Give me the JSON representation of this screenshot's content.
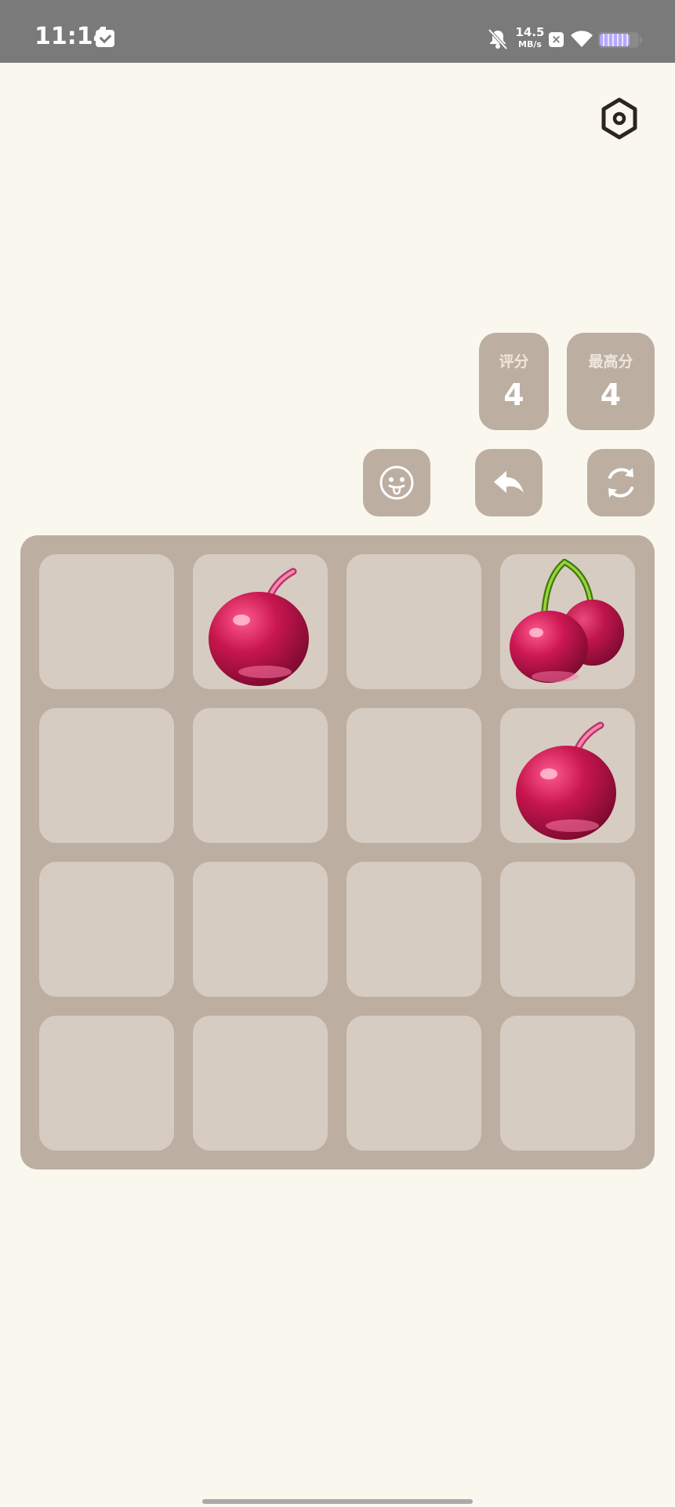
{
  "status_bar": {
    "time": "11:14",
    "network_speed_value": "14.5",
    "network_speed_unit": "MB/s",
    "battery_level": 0.8,
    "icons": [
      "mail-icon",
      "mute-icon",
      "data-x-icon",
      "wifi-icon",
      "battery-icon"
    ]
  },
  "header": {
    "settings_icon": "hexagon-settings-icon"
  },
  "score": {
    "label": "评分",
    "value": "4"
  },
  "best": {
    "label": "最高分",
    "value": "4"
  },
  "actions": [
    {
      "name": "emoji-button",
      "icon": "tongue-face-icon"
    },
    {
      "name": "undo-button",
      "icon": "back-arrow-icon"
    },
    {
      "name": "restart-button",
      "icon": "refresh-icon"
    }
  ],
  "board": {
    "rows": 4,
    "cols": 4,
    "tiles": [
      [
        "empty",
        "cherry-single",
        "empty",
        "cherry-double"
      ],
      [
        "empty",
        "empty",
        "empty",
        "cherry-single"
      ],
      [
        "empty",
        "empty",
        "empty",
        "empty"
      ],
      [
        "empty",
        "empty",
        "empty",
        "empty"
      ]
    ]
  },
  "colors": {
    "background": "#faf7ef",
    "panel": "#bcafa1",
    "cell": "#d7ccc2",
    "status_bar": "#7a7a7a",
    "cherry": "#c8164f"
  }
}
